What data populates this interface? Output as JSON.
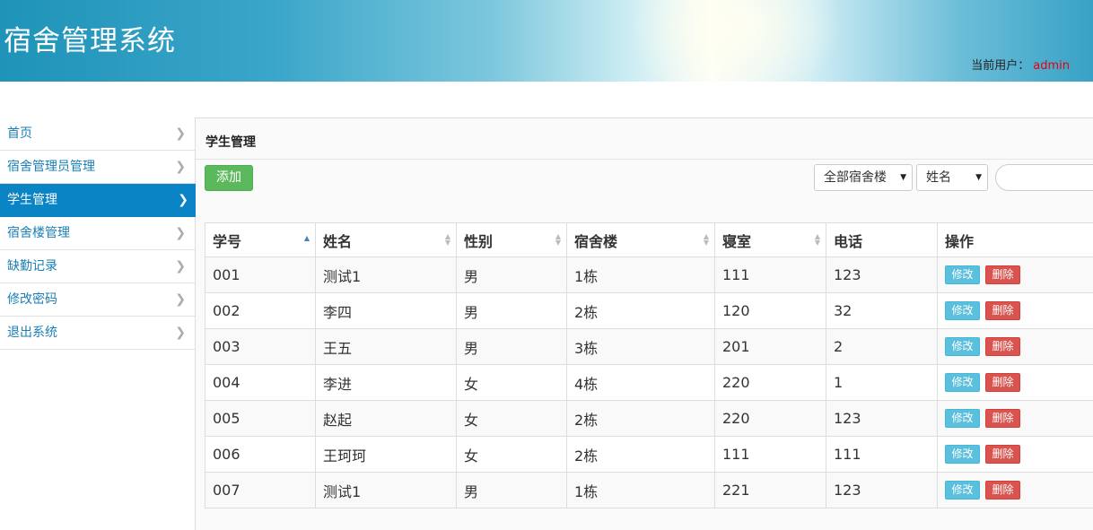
{
  "app": {
    "title": "宿舍管理系统",
    "current_user_label": "当前用户：",
    "current_user": "admin"
  },
  "sidebar": {
    "items": [
      {
        "label": "首页",
        "active": false
      },
      {
        "label": "宿舍管理员管理",
        "active": false
      },
      {
        "label": "学生管理",
        "active": true
      },
      {
        "label": "宿舍楼管理",
        "active": false
      },
      {
        "label": "缺勤记录",
        "active": false
      },
      {
        "label": "修改密码",
        "active": false
      },
      {
        "label": "退出系统",
        "active": false
      }
    ]
  },
  "main": {
    "title": "学生管理",
    "add_label": "添加",
    "building_filter": "全部宿舍楼",
    "field_filter": "姓名",
    "search_value": ""
  },
  "table": {
    "columns": [
      "学号",
      "姓名",
      "性别",
      "宿舍楼",
      "寝室",
      "电话",
      "操作"
    ],
    "edit_label": "修改",
    "delete_label": "删除",
    "rows": [
      [
        "001",
        "测试1",
        "男",
        "1栋",
        "111",
        "123"
      ],
      [
        "002",
        "李四",
        "男",
        "2栋",
        "120",
        "32"
      ],
      [
        "003",
        "王五",
        "男",
        "3栋",
        "201",
        "2"
      ],
      [
        "004",
        "李进",
        "女",
        "4栋",
        "220",
        "1"
      ],
      [
        "005",
        "赵起",
        "女",
        "2栋",
        "220",
        "123"
      ],
      [
        "006",
        "王珂珂",
        "女",
        "2栋",
        "111",
        "111"
      ],
      [
        "007",
        "测试1",
        "男",
        "1栋",
        "221",
        "123"
      ]
    ]
  },
  "colors": {
    "accent": "#0a84c5",
    "add": "#5cb85c",
    "edit": "#5bc0de",
    "delete": "#d9534f",
    "user": "#e60012"
  }
}
